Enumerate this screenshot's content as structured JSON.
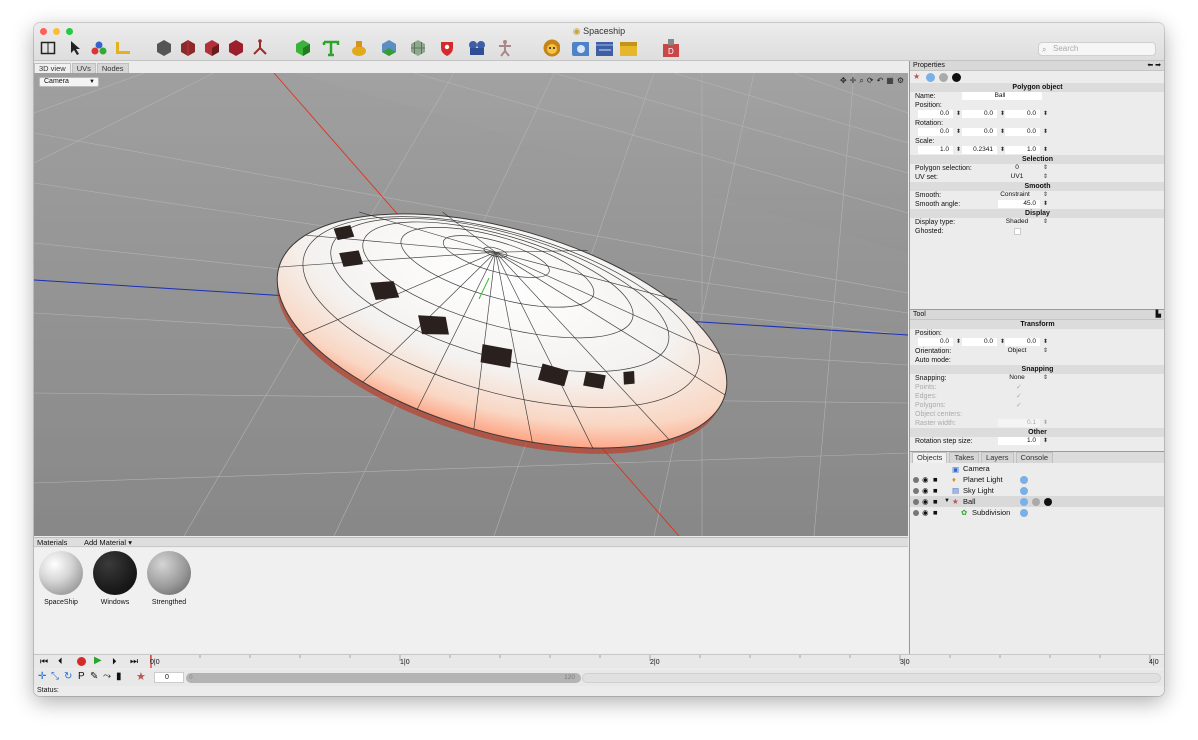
{
  "window": {
    "title": "Spaceship"
  },
  "search": {
    "placeholder": "Search"
  },
  "view_tabs": [
    "3D view",
    "UVs",
    "Nodes"
  ],
  "viewport": {
    "camera_select": "Camera"
  },
  "materials": {
    "header": "Materials",
    "add_label": "Add Material",
    "items": [
      {
        "name": "SpaceShip"
      },
      {
        "name": "Windows"
      },
      {
        "name": "Strengthed"
      }
    ]
  },
  "properties": {
    "header": "Properties",
    "object_type": "Polygon object",
    "name_label": "Name:",
    "name_value": "Ball",
    "position_label": "Position:",
    "position": [
      "0.0",
      "0.0",
      "0.0"
    ],
    "rotation_label": "Rotation:",
    "rotation": [
      "0.0",
      "0.0",
      "0.0"
    ],
    "scale_label": "Scale:",
    "scale": [
      "1.0",
      "0.2341",
      "1.0"
    ],
    "selection_group": "Selection",
    "polygon_selection_label": "Polygon selection:",
    "polygon_selection": "0",
    "uv_set_label": "UV set:",
    "uv_set": "UV1",
    "smooth_group": "Smooth",
    "smooth_label": "Smooth:",
    "smooth": "Constraint",
    "smooth_angle_label": "Smooth angle:",
    "smooth_angle": "45.0",
    "display_group": "Display",
    "display_type_label": "Display type:",
    "display_type": "Shaded",
    "ghosted_label": "Ghosted:"
  },
  "tool": {
    "header": "Tool",
    "transform_group": "Transform",
    "position_label": "Position:",
    "position": [
      "0.0",
      "0.0",
      "0.0"
    ],
    "orientation_label": "Orientation:",
    "orientation": "Object",
    "auto_mode_label": "Auto mode:",
    "snapping_group": "Snapping",
    "snapping_label": "Snapping:",
    "snapping": "None",
    "points_label": "Points:",
    "edges_label": "Edges:",
    "polygons_label": "Polygons:",
    "object_centers_label": "Object centers:",
    "raster_width_label": "Raster width:",
    "raster_width": "0.1",
    "other_group": "Other",
    "rotation_step_label": "Rotation step size:",
    "rotation_step": "1.0"
  },
  "objects_tabs": [
    "Objects",
    "Takes",
    "Layers",
    "Console"
  ],
  "objects": [
    {
      "name": "Camera"
    },
    {
      "name": "Planet Light"
    },
    {
      "name": "Sky Light"
    },
    {
      "name": "Ball"
    },
    {
      "name": "Subdivision"
    }
  ],
  "timeline": {
    "ticks": [
      "0|0",
      "1|0",
      "2|0",
      "3|0",
      "4|0"
    ],
    "frame": "0",
    "range_end": "120"
  },
  "status": {
    "label": "Status:"
  },
  "colors": {
    "accent_red": "#e8230d",
    "axis_blue": "#1a2fb8",
    "axis_green": "#39c030",
    "selection": "#d9d9d9"
  }
}
